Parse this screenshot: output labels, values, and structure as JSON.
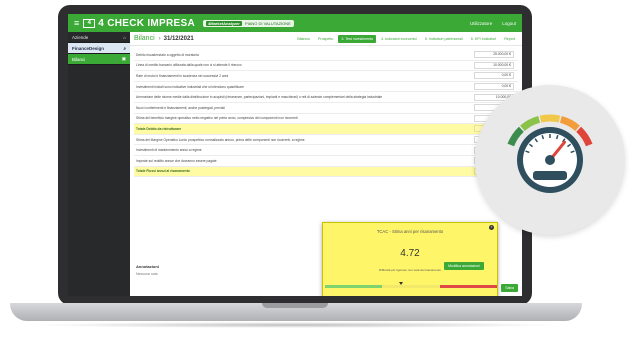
{
  "app": {
    "title": "4 CHECK IMPRESA",
    "company_badge": "4MarketAnalyzer",
    "company_text": "PIANO DI VALUTAZIONE",
    "user_link": "Utilizzatore",
    "logout_link": "Logout"
  },
  "sidebar": {
    "items": [
      {
        "label": "Aziende",
        "count": "⌂"
      },
      {
        "label": "FinanceDesign",
        "count": "⌕"
      },
      {
        "label": "Bilanci",
        "count": "▣"
      }
    ]
  },
  "header": {
    "title": "Bilanci",
    "date": "31/12/2021",
    "tabs": [
      "Bilancio",
      "Prospetto",
      "3. Test investimento",
      "4. Indicatori economici",
      "5. Indicatori patrimoniali",
      "6. KPI Indicatori",
      "Report"
    ]
  },
  "table": {
    "rows": [
      {
        "label": "Debito riscadenziato a oggetto di moratoria",
        "value": "25.000,00 €",
        "total": false
      },
      {
        "label": "Linea di credito bancario utilizzata dalla quale non ci si attende il rinnovo",
        "value": "10.000,00 €",
        "total": false
      },
      {
        "label": "Rate di mutui e finanziamenti in scadenza nei successivi 2 anni",
        "value": "0,00 €",
        "total": false
      },
      {
        "label": "Investimenti iniziali sono indicative industriali che si intendono quantificare",
        "value": "0,00 €",
        "total": false
      },
      {
        "label": "Ammontare delle risorse medie dalla distribuzione in acquisti (rimanenze, partecipazioni, impianti e macchinari) o reti di aziende complementari della strategia industriale",
        "value": "10.000,00",
        "total": false
      },
      {
        "label": "Nuovi conferimenti e finanziamenti, anche postergati, previsti",
        "value": "",
        "total": false
      },
      {
        "label": "Stima del beneficio margine operativo netto negativo nel primo anno, compresivo dei componenti non ricorrenti",
        "value": "16.0",
        "total": false
      },
      {
        "label": "Totale Debito da ristrutturare",
        "value": "",
        "total": true
      },
      {
        "label": "Stima del Margine Operativo Lordo prospettico normalizzato annuo, prima delle componenti non ricorrenti, a regime",
        "value": "",
        "total": false
      },
      {
        "label": "Investimenti di mantenimento annui a regime",
        "value": "",
        "total": false
      },
      {
        "label": "Imposte sul reddito annue che dovranno essere pagate",
        "value": "",
        "total": false
      },
      {
        "label": "Totale Flussi annui al risanamento",
        "value": "1.15",
        "total": true
      }
    ]
  },
  "modal": {
    "title": "TCAC - Stima anni per risanamento",
    "value": "4.72",
    "legend": "Difficoltà più rigoroso non sarà da risanamento",
    "close": "×",
    "marker_fraction": 0.44,
    "segments": [
      "#7fd36e",
      "#f2e86a",
      "#e04848"
    ]
  },
  "notes": {
    "title": "Annotazioni",
    "text": "Nessuna nota",
    "button": "Modifica annotazioni"
  },
  "footer": {
    "button": "Salva"
  },
  "colors": {
    "brand_green": "#3aa935",
    "total_yellow": "#fffaa4",
    "modal_yellow": "#fff568",
    "sidebar_dark": "#27292b"
  },
  "gauge": {
    "icon": "speedometer-icon",
    "segment_colors": [
      "#3c8c4e",
      "#8bc34a",
      "#f2c84a",
      "#f39c3b",
      "#e0453b"
    ],
    "needle_fraction": 0.78
  }
}
